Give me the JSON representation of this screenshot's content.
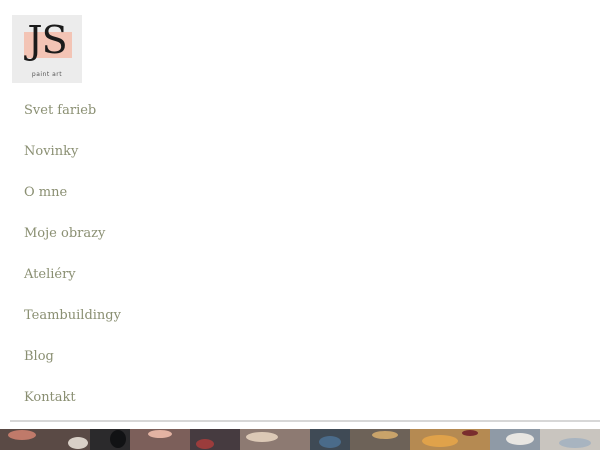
{
  "logo": {
    "monogram": "JS",
    "tagline": "paint art"
  },
  "nav": {
    "items": [
      {
        "label": "Svet farieb"
      },
      {
        "label": "Novinky"
      },
      {
        "label": "O mne"
      },
      {
        "label": "Moje obrazy"
      },
      {
        "label": "Ateliéry"
      },
      {
        "label": "Teambuildingy"
      },
      {
        "label": "Blog"
      },
      {
        "label": "Kontakt"
      }
    ]
  },
  "colors": {
    "nav_text": "#8a8f72",
    "logo_background": "#ececec",
    "logo_accent": "#f3c4b5",
    "divider": "#d7d7d7"
  },
  "hero": {
    "image": "abstract-paint-palette-image"
  }
}
